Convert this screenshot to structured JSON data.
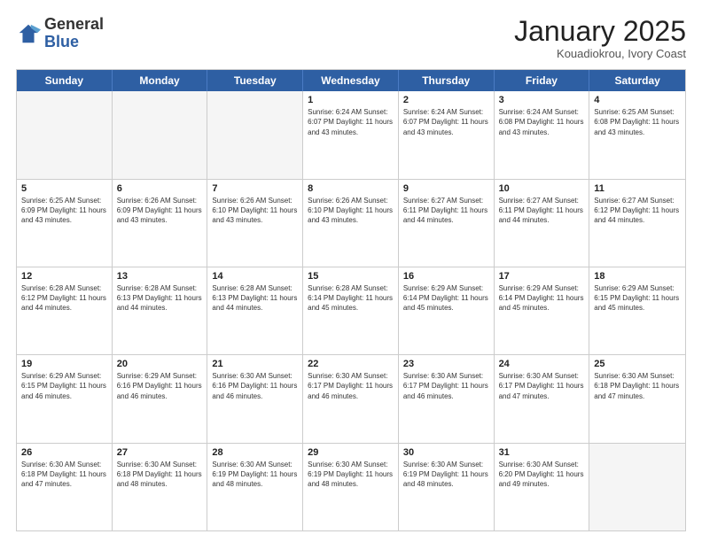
{
  "header": {
    "logo_general": "General",
    "logo_blue": "Blue",
    "month_title": "January 2025",
    "subtitle": "Kouadiokrou, Ivory Coast"
  },
  "weekdays": [
    "Sunday",
    "Monday",
    "Tuesday",
    "Wednesday",
    "Thursday",
    "Friday",
    "Saturday"
  ],
  "rows": [
    [
      {
        "day": "",
        "text": ""
      },
      {
        "day": "",
        "text": ""
      },
      {
        "day": "",
        "text": ""
      },
      {
        "day": "1",
        "text": "Sunrise: 6:24 AM\nSunset: 6:07 PM\nDaylight: 11 hours\nand 43 minutes."
      },
      {
        "day": "2",
        "text": "Sunrise: 6:24 AM\nSunset: 6:07 PM\nDaylight: 11 hours\nand 43 minutes."
      },
      {
        "day": "3",
        "text": "Sunrise: 6:24 AM\nSunset: 6:08 PM\nDaylight: 11 hours\nand 43 minutes."
      },
      {
        "day": "4",
        "text": "Sunrise: 6:25 AM\nSunset: 6:08 PM\nDaylight: 11 hours\nand 43 minutes."
      }
    ],
    [
      {
        "day": "5",
        "text": "Sunrise: 6:25 AM\nSunset: 6:09 PM\nDaylight: 11 hours\nand 43 minutes."
      },
      {
        "day": "6",
        "text": "Sunrise: 6:26 AM\nSunset: 6:09 PM\nDaylight: 11 hours\nand 43 minutes."
      },
      {
        "day": "7",
        "text": "Sunrise: 6:26 AM\nSunset: 6:10 PM\nDaylight: 11 hours\nand 43 minutes."
      },
      {
        "day": "8",
        "text": "Sunrise: 6:26 AM\nSunset: 6:10 PM\nDaylight: 11 hours\nand 43 minutes."
      },
      {
        "day": "9",
        "text": "Sunrise: 6:27 AM\nSunset: 6:11 PM\nDaylight: 11 hours\nand 44 minutes."
      },
      {
        "day": "10",
        "text": "Sunrise: 6:27 AM\nSunset: 6:11 PM\nDaylight: 11 hours\nand 44 minutes."
      },
      {
        "day": "11",
        "text": "Sunrise: 6:27 AM\nSunset: 6:12 PM\nDaylight: 11 hours\nand 44 minutes."
      }
    ],
    [
      {
        "day": "12",
        "text": "Sunrise: 6:28 AM\nSunset: 6:12 PM\nDaylight: 11 hours\nand 44 minutes."
      },
      {
        "day": "13",
        "text": "Sunrise: 6:28 AM\nSunset: 6:13 PM\nDaylight: 11 hours\nand 44 minutes."
      },
      {
        "day": "14",
        "text": "Sunrise: 6:28 AM\nSunset: 6:13 PM\nDaylight: 11 hours\nand 44 minutes."
      },
      {
        "day": "15",
        "text": "Sunrise: 6:28 AM\nSunset: 6:14 PM\nDaylight: 11 hours\nand 45 minutes."
      },
      {
        "day": "16",
        "text": "Sunrise: 6:29 AM\nSunset: 6:14 PM\nDaylight: 11 hours\nand 45 minutes."
      },
      {
        "day": "17",
        "text": "Sunrise: 6:29 AM\nSunset: 6:14 PM\nDaylight: 11 hours\nand 45 minutes."
      },
      {
        "day": "18",
        "text": "Sunrise: 6:29 AM\nSunset: 6:15 PM\nDaylight: 11 hours\nand 45 minutes."
      }
    ],
    [
      {
        "day": "19",
        "text": "Sunrise: 6:29 AM\nSunset: 6:15 PM\nDaylight: 11 hours\nand 46 minutes."
      },
      {
        "day": "20",
        "text": "Sunrise: 6:29 AM\nSunset: 6:16 PM\nDaylight: 11 hours\nand 46 minutes."
      },
      {
        "day": "21",
        "text": "Sunrise: 6:30 AM\nSunset: 6:16 PM\nDaylight: 11 hours\nand 46 minutes."
      },
      {
        "day": "22",
        "text": "Sunrise: 6:30 AM\nSunset: 6:17 PM\nDaylight: 11 hours\nand 46 minutes."
      },
      {
        "day": "23",
        "text": "Sunrise: 6:30 AM\nSunset: 6:17 PM\nDaylight: 11 hours\nand 46 minutes."
      },
      {
        "day": "24",
        "text": "Sunrise: 6:30 AM\nSunset: 6:17 PM\nDaylight: 11 hours\nand 47 minutes."
      },
      {
        "day": "25",
        "text": "Sunrise: 6:30 AM\nSunset: 6:18 PM\nDaylight: 11 hours\nand 47 minutes."
      }
    ],
    [
      {
        "day": "26",
        "text": "Sunrise: 6:30 AM\nSunset: 6:18 PM\nDaylight: 11 hours\nand 47 minutes."
      },
      {
        "day": "27",
        "text": "Sunrise: 6:30 AM\nSunset: 6:18 PM\nDaylight: 11 hours\nand 48 minutes."
      },
      {
        "day": "28",
        "text": "Sunrise: 6:30 AM\nSunset: 6:19 PM\nDaylight: 11 hours\nand 48 minutes."
      },
      {
        "day": "29",
        "text": "Sunrise: 6:30 AM\nSunset: 6:19 PM\nDaylight: 11 hours\nand 48 minutes."
      },
      {
        "day": "30",
        "text": "Sunrise: 6:30 AM\nSunset: 6:19 PM\nDaylight: 11 hours\nand 48 minutes."
      },
      {
        "day": "31",
        "text": "Sunrise: 6:30 AM\nSunset: 6:20 PM\nDaylight: 11 hours\nand 49 minutes."
      },
      {
        "day": "",
        "text": ""
      }
    ]
  ]
}
